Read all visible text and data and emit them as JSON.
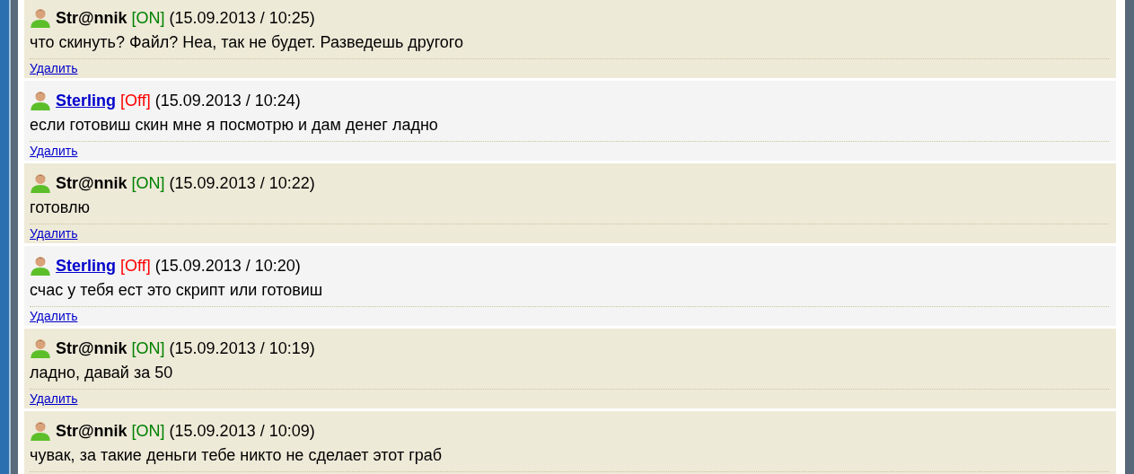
{
  "messages": [
    {
      "kind": "self",
      "author": "Str@nnik",
      "status": "[ON]",
      "online": true,
      "time": "(15.09.2013 / 10:25)",
      "text": "что скинуть? Файл? Неа, так не будет. Разведешь другого",
      "delete_link": "Удалить"
    },
    {
      "kind": "other",
      "author": "Sterling",
      "status": "[Off]",
      "online": false,
      "time": "(15.09.2013 / 10:24)",
      "text": "если готовиш скин мне я посмотрю и дам денег ладно",
      "delete_link": "Удалить"
    },
    {
      "kind": "self",
      "author": "Str@nnik",
      "status": "[ON]",
      "online": true,
      "time": "(15.09.2013 / 10:22)",
      "text": "готовлю",
      "delete_link": "Удалить"
    },
    {
      "kind": "other",
      "author": "Sterling",
      "status": "[Off]",
      "online": false,
      "time": "(15.09.2013 / 10:20)",
      "text": "счас у тебя ест это скрипт или готовиш",
      "delete_link": "Удалить"
    },
    {
      "kind": "self",
      "author": "Str@nnik",
      "status": "[ON]",
      "online": true,
      "time": "(15.09.2013 / 10:19)",
      "text": "ладно, давай за 50",
      "delete_link": "Удалить"
    },
    {
      "kind": "self",
      "author": "Str@nnik",
      "status": "[ON]",
      "online": true,
      "time": "(15.09.2013 / 10:09)",
      "text": "чувак, за такие деньги тебе никто не сделает этот граб"
    }
  ]
}
